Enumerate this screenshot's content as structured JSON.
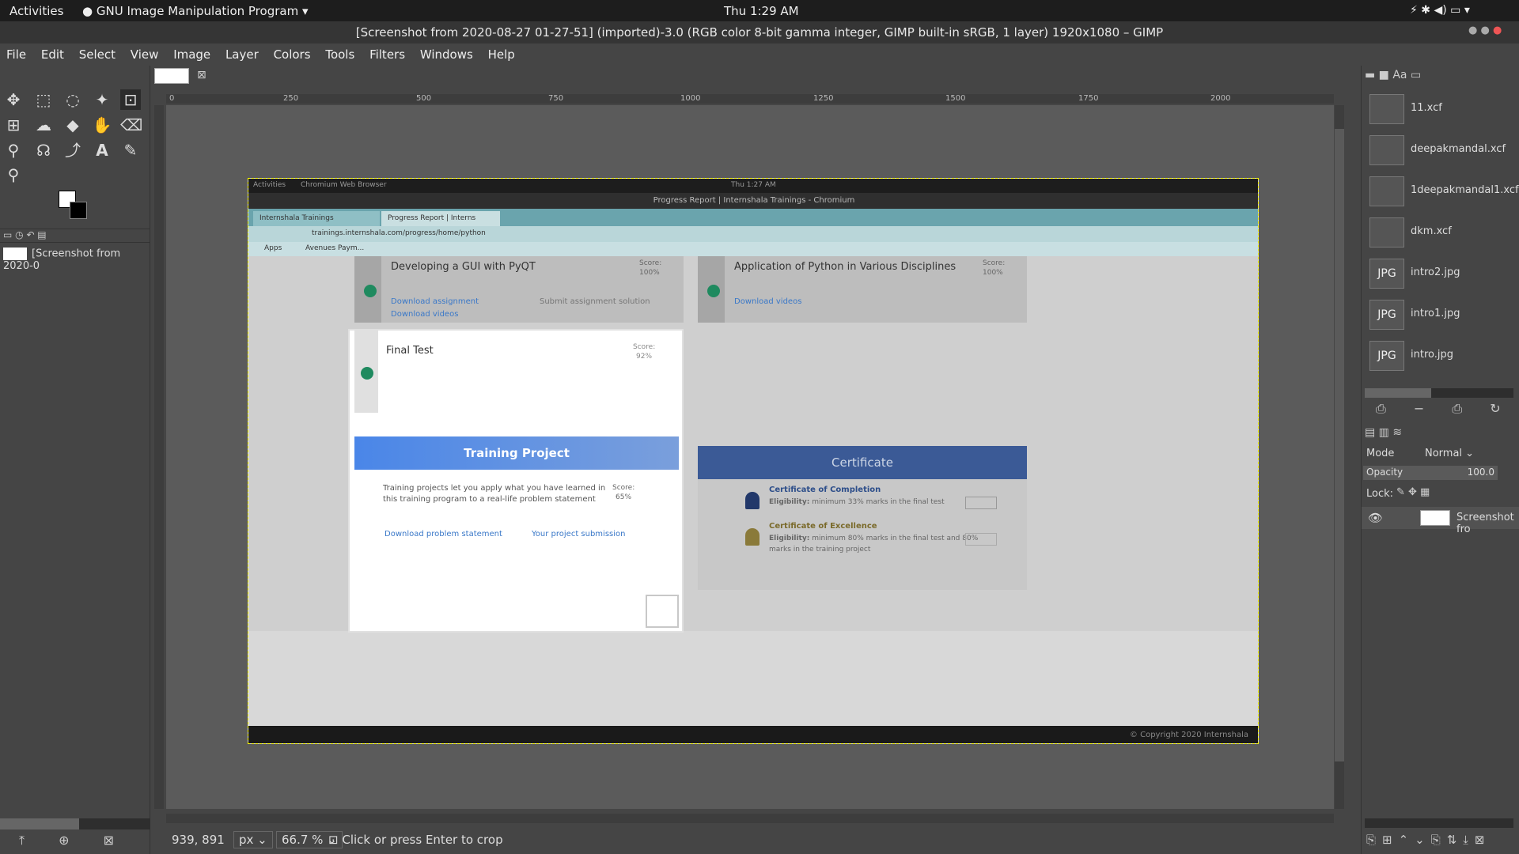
{
  "system": {
    "activities": "Activities",
    "app": "GNU Image Manipulation Program",
    "time": "Thu  1:29 AM"
  },
  "window": {
    "title": "[Screenshot from 2020-08-27 01-27-51] (imported)-3.0 (RGB color 8-bit gamma integer, GIMP built-in sRGB, 1 layer) 1920x1080 – GIMP"
  },
  "menu": [
    "File",
    "Edit",
    "Select",
    "View",
    "Image",
    "Layer",
    "Colors",
    "Tools",
    "Filters",
    "Windows",
    "Help"
  ],
  "left": {
    "image_item": "[Screenshot from 2020-0"
  },
  "ruler": [
    "0",
    "250",
    "500",
    "750",
    "1000",
    "1250",
    "1500",
    "1750",
    "2000"
  ],
  "inner": {
    "topbar": {
      "activities": "Activities",
      "app": "Chromium Web Browser",
      "time": "Thu  1:27 AM"
    },
    "title": "Progress Report | Internshala Trainings - Chromium",
    "tabs": [
      "Internshala Trainings",
      "Progress Report | Interns"
    ],
    "url": "trainings.internshala.com/progress/home/python",
    "bookmarks": [
      "Apps",
      "Avenues Paym..."
    ],
    "cards": {
      "c1_title": "Developing a GUI with PyQT",
      "c1_score": "Score:",
      "c1_val": "100%",
      "c1_dl_assign": "Download assignment",
      "c1_submit": "Submit assignment solution",
      "c1_dl_videos": "Download videos",
      "c2_title": "Application of Python in Various Disciplines",
      "c2_score": "Score:",
      "c2_val": "100%",
      "c2_dl_videos": "Download videos",
      "final_title": "Final Test",
      "final_score": "Score:",
      "final_val": "92%"
    },
    "project": {
      "heading": "Training Project",
      "desc1": "Training projects let you apply what you have learned in",
      "desc2": "this training program to a real-life problem statement",
      "score": "Score:",
      "val": "65%",
      "dl": "Download problem statement",
      "sub": "Your project submission"
    },
    "cert": {
      "heading": "Certificate",
      "c1": "Certificate of Completion",
      "c1_elig_label": "Eligibility:",
      "c1_elig": "minimum 33% marks in the final test",
      "c2": "Certificate of Excellence",
      "c2_elig_label": "Eligibility:",
      "c2_elig": "minimum 80% marks in the final test and 80%",
      "c2_elig2": "marks in the training project"
    },
    "footer": "© Copyright 2020 Internshala"
  },
  "right": {
    "images": [
      "11.xcf",
      "deepakmandal.xcf",
      "1deepakmandal1.xcf",
      "dkm.xcf",
      "intro2.jpg",
      "intro1.jpg",
      "intro.jpg"
    ],
    "thumb_label": "JPG",
    "mode_label": "Mode",
    "mode_value": "Normal",
    "opacity_label": "Opacity",
    "opacity_value": "100.0",
    "lock_label": "Lock:",
    "layer_name": "Screenshot fro"
  },
  "status": {
    "coords": "939, 891",
    "unit": "px",
    "zoom": "66.7 %",
    "message": "Click or press Enter to crop"
  }
}
